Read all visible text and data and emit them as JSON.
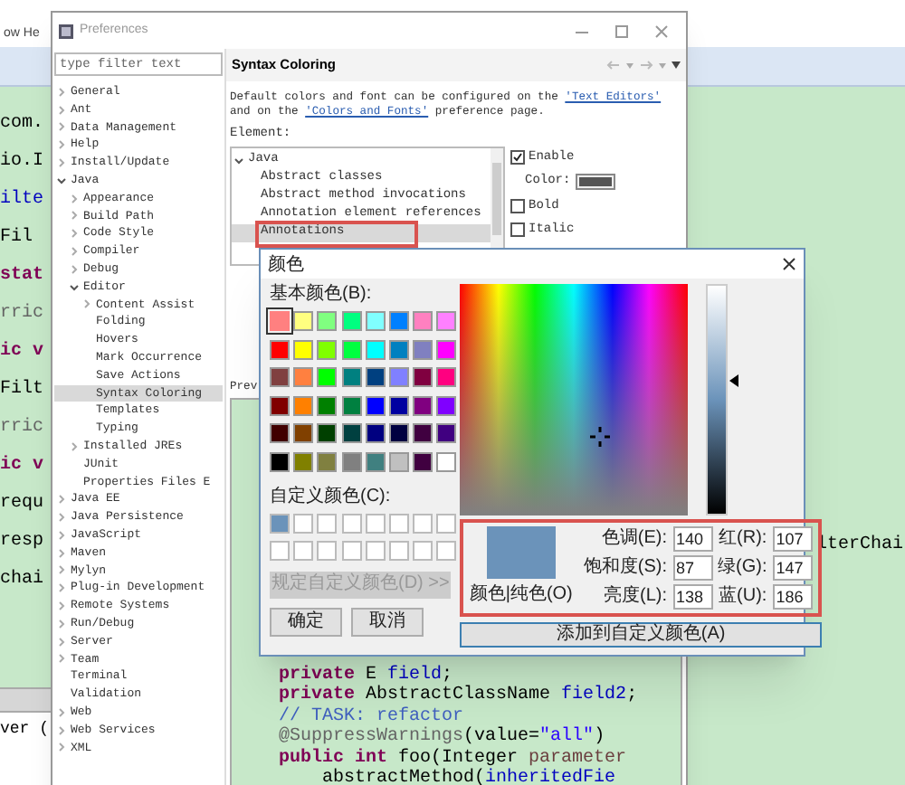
{
  "editor": {
    "menu_fragment": "ow He",
    "code_fragments": [
      {
        "text": "com.",
        "kind": "plain"
      },
      {
        "text": "io.I",
        "kind": "plain"
      },
      {
        "text": "ilte",
        "kind": "field"
      },
      {
        "text": "Fil",
        "kind": "plain"
      },
      {
        "text": "stat",
        "kind": "keyword"
      },
      {
        "text": "rric",
        "kind": "annotation"
      },
      {
        "text": "ic v",
        "kind": "keyword"
      },
      {
        "text": "Filt",
        "kind": "plain"
      },
      {
        "text": "rric",
        "kind": "annotation"
      },
      {
        "text": "ic v",
        "kind": "keyword"
      },
      {
        "text": "requ",
        "kind": "plain"
      },
      {
        "text": "resp",
        "kind": "plain"
      },
      {
        "text": "chai",
        "kind": "plain"
      }
    ],
    "right_fragment": "lterChai",
    "console_fragment": "ver ("
  },
  "preferences": {
    "title": "Preferences",
    "filter": {
      "placeholder": "type filter text"
    },
    "tree": [
      {
        "label": "General",
        "expanded": false,
        "selected": false
      },
      {
        "label": "Ant",
        "expanded": false,
        "selected": false
      },
      {
        "label": "Data Management",
        "expanded": false,
        "selected": false
      },
      {
        "label": "Help",
        "expanded": false,
        "selected": false
      },
      {
        "label": "Install/Update",
        "expanded": false,
        "selected": false
      },
      {
        "label": "Java",
        "expanded": true,
        "selected": false,
        "children": [
          {
            "label": "Appearance",
            "expanded": false,
            "selected": false
          },
          {
            "label": "Build Path",
            "expanded": false,
            "selected": false
          },
          {
            "label": "Code Style",
            "expanded": false,
            "selected": false
          },
          {
            "label": "Compiler",
            "expanded": false,
            "selected": false
          },
          {
            "label": "Debug",
            "expanded": false,
            "selected": false
          },
          {
            "label": "Editor",
            "expanded": true,
            "selected": false,
            "children": [
              {
                "label": "Content Assist",
                "expanded": false,
                "selected": false
              },
              {
                "label": "Folding",
                "selected": false
              },
              {
                "label": "Hovers",
                "selected": false
              },
              {
                "label": "Mark Occurrence",
                "selected": false
              },
              {
                "label": "Save Actions",
                "selected": false
              },
              {
                "label": "Syntax Coloring",
                "selected": true
              },
              {
                "label": "Templates",
                "selected": false
              },
              {
                "label": "Typing",
                "selected": false
              }
            ]
          },
          {
            "label": "Installed JREs",
            "expanded": false,
            "selected": false
          },
          {
            "label": "JUnit",
            "selected": false
          },
          {
            "label": "Properties Files E",
            "selected": false
          }
        ]
      },
      {
        "label": "Java EE",
        "expanded": false,
        "selected": false
      },
      {
        "label": "Java Persistence",
        "expanded": false,
        "selected": false
      },
      {
        "label": "JavaScript",
        "expanded": false,
        "selected": false
      },
      {
        "label": "Maven",
        "expanded": false,
        "selected": false
      },
      {
        "label": "Mylyn",
        "expanded": false,
        "selected": false
      },
      {
        "label": "Plug-in Development",
        "expanded": false,
        "selected": false
      },
      {
        "label": "Remote Systems",
        "expanded": false,
        "selected": false
      },
      {
        "label": "Run/Debug",
        "expanded": false,
        "selected": false
      },
      {
        "label": "Server",
        "expanded": false,
        "selected": false
      },
      {
        "label": "Team",
        "expanded": false,
        "selected": false
      },
      {
        "label": "Terminal",
        "selected": false
      },
      {
        "label": "Validation",
        "selected": false
      },
      {
        "label": "Web",
        "expanded": false,
        "selected": false
      },
      {
        "label": "Web Services",
        "expanded": false,
        "selected": false
      },
      {
        "label": "XML",
        "expanded": false,
        "selected": false
      }
    ],
    "page": {
      "title": "Syntax Coloring",
      "description": [
        {
          "text": "Default colors and font can be configured on the ",
          "kind": "text"
        },
        {
          "text": "'Text Editors'",
          "kind": "link"
        },
        {
          "text": " and on the ",
          "kind": "text"
        },
        {
          "text": "'Colors and Fonts'",
          "kind": "link"
        },
        {
          "text": " preference page.",
          "kind": "text"
        }
      ],
      "element_label": "Element:",
      "elements": [
        {
          "label": "Java",
          "expanded": true,
          "selected": false,
          "children": [
            {
              "label": "Abstract classes",
              "selected": false
            },
            {
              "label": "Abstract method invocations",
              "selected": false
            },
            {
              "label": "Annotation element references",
              "selected": false
            },
            {
              "label": "Annotations",
              "selected": true
            }
          ]
        }
      ],
      "options": [
        {
          "kind": "checkbox",
          "label": "Enable",
          "checked": true
        },
        {
          "kind": "color",
          "label": "Color:",
          "color": "#555555"
        },
        {
          "kind": "checkbox",
          "label": "Bold",
          "checked": false
        },
        {
          "kind": "checkbox",
          "label": "Italic",
          "checked": false
        }
      ],
      "preview_label": "Prev",
      "preview_lines": [
        [
          {
            "text": "private",
            "kind": "keyword"
          },
          {
            "text": " E ",
            "kind": "plain"
          },
          {
            "text": "field",
            "kind": "field"
          },
          {
            "text": ";",
            "kind": "plain"
          }
        ],
        [
          {
            "text": "private",
            "kind": "keyword"
          },
          {
            "text": " AbstractClassName ",
            "kind": "plain"
          },
          {
            "text": "field2",
            "kind": "field"
          },
          {
            "text": ";",
            "kind": "plain"
          }
        ],
        [
          {
            "text": "// TASK: refactor",
            "kind": "comment"
          }
        ],
        [
          {
            "text": "@SuppressWarnings",
            "kind": "annotation"
          },
          {
            "text": "(value=",
            "kind": "plain"
          },
          {
            "text": "\"all\"",
            "kind": "string"
          },
          {
            "text": ")",
            "kind": "plain"
          }
        ],
        [
          {
            "text": "public ",
            "kind": "keyword"
          },
          {
            "text": "int",
            "kind": "keyword"
          },
          {
            "text": " foo(Integer ",
            "kind": "plain"
          },
          {
            "text": "parameter",
            "kind": "param"
          }
        ],
        [
          {
            "text": "    abstractMethod(",
            "kind": "plain"
          },
          {
            "text": "inheritedFie",
            "kind": "field"
          }
        ]
      ]
    }
  },
  "color_dialog": {
    "title": "颜色",
    "basic_label": "基本颜色(B):",
    "basic_colors": [
      {
        "color": "#ff8080",
        "selected": true
      },
      {
        "color": "#ffff80",
        "selected": false
      },
      {
        "color": "#80ff80",
        "selected": false
      },
      {
        "color": "#00ff80",
        "selected": false
      },
      {
        "color": "#80ffff",
        "selected": false
      },
      {
        "color": "#0080ff",
        "selected": false
      },
      {
        "color": "#ff80c0",
        "selected": false
      },
      {
        "color": "#ff80ff",
        "selected": false
      },
      {
        "color": "#ff0000",
        "selected": false
      },
      {
        "color": "#ffff00",
        "selected": false
      },
      {
        "color": "#80ff00",
        "selected": false
      },
      {
        "color": "#00ff40",
        "selected": false
      },
      {
        "color": "#00ffff",
        "selected": false
      },
      {
        "color": "#0080c0",
        "selected": false
      },
      {
        "color": "#8080c0",
        "selected": false
      },
      {
        "color": "#ff00ff",
        "selected": false
      },
      {
        "color": "#804040",
        "selected": false
      },
      {
        "color": "#ff8040",
        "selected": false
      },
      {
        "color": "#00ff00",
        "selected": false
      },
      {
        "color": "#008080",
        "selected": false
      },
      {
        "color": "#004080",
        "selected": false
      },
      {
        "color": "#8080ff",
        "selected": false
      },
      {
        "color": "#800040",
        "selected": false
      },
      {
        "color": "#ff0080",
        "selected": false
      },
      {
        "color": "#800000",
        "selected": false
      },
      {
        "color": "#ff8000",
        "selected": false
      },
      {
        "color": "#008000",
        "selected": false
      },
      {
        "color": "#008040",
        "selected": false
      },
      {
        "color": "#0000ff",
        "selected": false
      },
      {
        "color": "#0000a0",
        "selected": false
      },
      {
        "color": "#800080",
        "selected": false
      },
      {
        "color": "#8000ff",
        "selected": false
      },
      {
        "color": "#400000",
        "selected": false
      },
      {
        "color": "#804000",
        "selected": false
      },
      {
        "color": "#004000",
        "selected": false
      },
      {
        "color": "#004040",
        "selected": false
      },
      {
        "color": "#000080",
        "selected": false
      },
      {
        "color": "#000040",
        "selected": false
      },
      {
        "color": "#400040",
        "selected": false
      },
      {
        "color": "#400080",
        "selected": false
      },
      {
        "color": "#000000",
        "selected": false
      },
      {
        "color": "#808000",
        "selected": false
      },
      {
        "color": "#808040",
        "selected": false
      },
      {
        "color": "#808080",
        "selected": false
      },
      {
        "color": "#408080",
        "selected": false
      },
      {
        "color": "#c0c0c0",
        "selected": false
      },
      {
        "color": "#400040",
        "selected": false
      },
      {
        "color": "#ffffff",
        "selected": false
      }
    ],
    "custom_label": "自定义颜色(C):",
    "custom_colors": [
      {
        "color": "#6b93ba"
      },
      {
        "color": "#ffffff"
      },
      {
        "color": "#ffffff"
      },
      {
        "color": "#ffffff"
      },
      {
        "color": "#ffffff"
      },
      {
        "color": "#ffffff"
      },
      {
        "color": "#ffffff"
      },
      {
        "color": "#ffffff"
      },
      {
        "color": "#ffffff"
      },
      {
        "color": "#ffffff"
      },
      {
        "color": "#ffffff"
      },
      {
        "color": "#ffffff"
      },
      {
        "color": "#ffffff"
      },
      {
        "color": "#ffffff"
      },
      {
        "color": "#ffffff"
      },
      {
        "color": "#ffffff"
      }
    ],
    "define_button": {
      "label": "规定自定义颜色(D) >>",
      "disabled": true
    },
    "ok_button": "确定",
    "cancel_button": "取消",
    "luminance": {
      "level": 0.58
    },
    "current": {
      "color": "#6b93ba",
      "label": "颜色|纯色(O)"
    },
    "fields": [
      {
        "label": "色调(E):",
        "value": "140"
      },
      {
        "label": "红(R):",
        "value": "107"
      },
      {
        "label": "饱和度(S):",
        "value": "87"
      },
      {
        "label": "绿(G):",
        "value": "147"
      },
      {
        "label": "亮度(L):",
        "value": "138"
      },
      {
        "label": "蓝(U):",
        "value": "186"
      }
    ],
    "add_button": {
      "label": "添加到自定义颜色(A)",
      "focused": true
    }
  }
}
